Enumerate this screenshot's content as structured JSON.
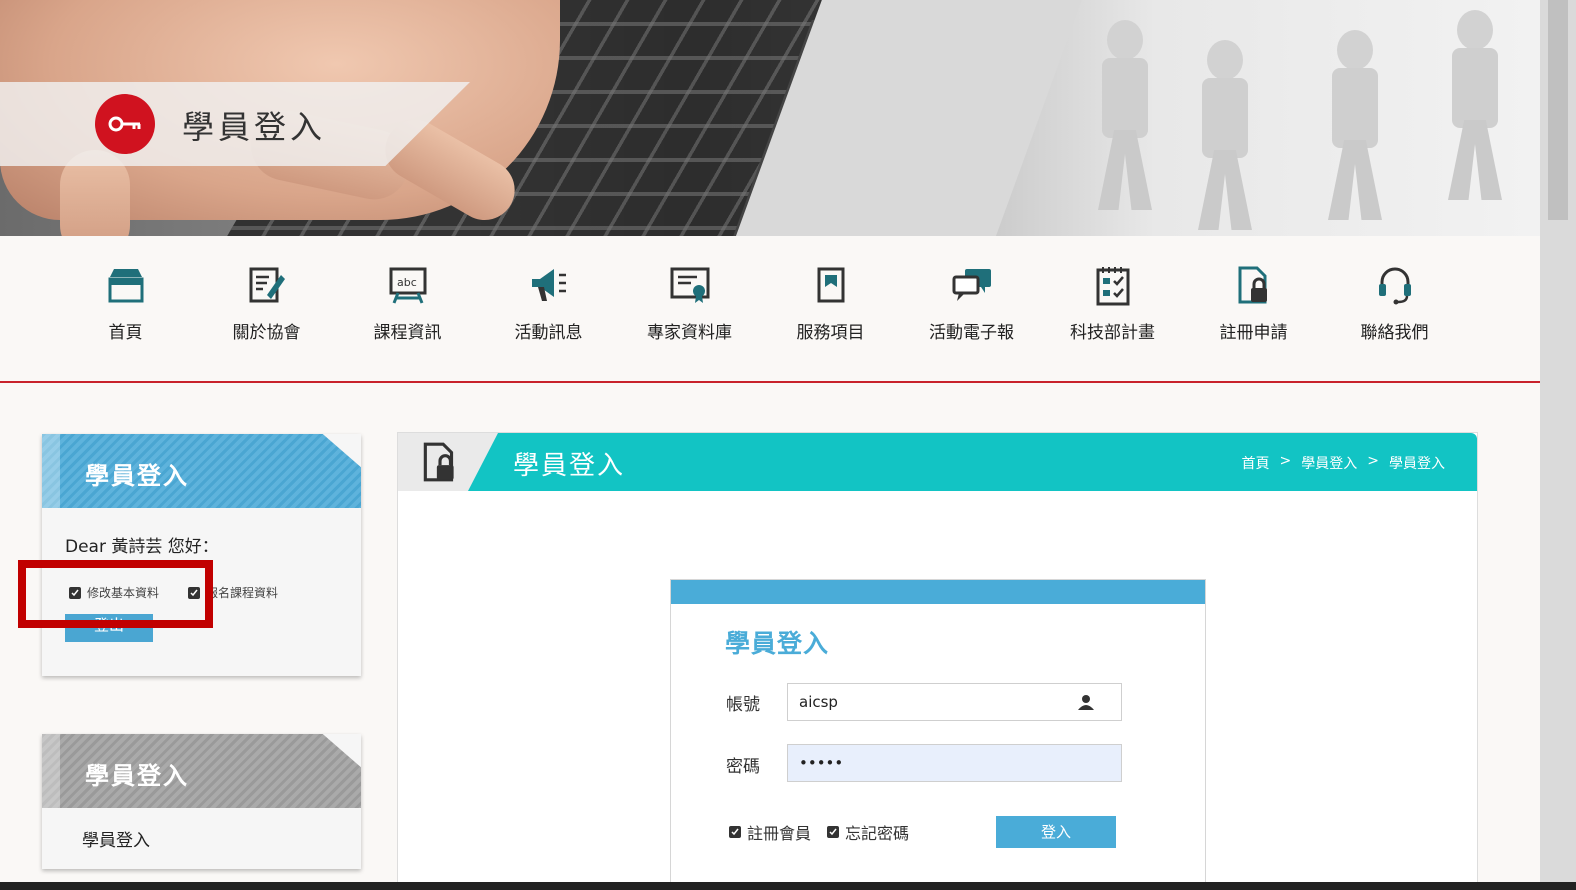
{
  "banner": {
    "title": "學員登入"
  },
  "nav": {
    "items": [
      {
        "label": "首頁",
        "icon": "home-icon"
      },
      {
        "label": "關於協會",
        "icon": "edit-note-icon"
      },
      {
        "label": "課程資訊",
        "icon": "abc-board-icon"
      },
      {
        "label": "活動訊息",
        "icon": "megaphone-icon"
      },
      {
        "label": "專家資料庫",
        "icon": "certificate-icon"
      },
      {
        "label": "服務項目",
        "icon": "bookmark-icon"
      },
      {
        "label": "活動電子報",
        "icon": "chat-bubbles-icon"
      },
      {
        "label": "科技部計畫",
        "icon": "checklist-icon"
      },
      {
        "label": "註冊申請",
        "icon": "lock-document-icon"
      },
      {
        "label": "聯絡我們",
        "icon": "headset-icon"
      }
    ]
  },
  "sidebar": {
    "member_card": {
      "title": "學員登入",
      "greeting": "Dear 黃詩芸 您好：",
      "links": [
        "修改基本資料",
        "報名課程資料"
      ],
      "logout_label": "登出"
    },
    "login_card": {
      "title": "學員登入",
      "item": "學員登入"
    }
  },
  "main": {
    "title": "學員登入",
    "breadcrumb": [
      "首頁",
      ">",
      "學員登入",
      ">",
      "學員登入"
    ]
  },
  "login_form": {
    "title": "學員登入",
    "account_label": "帳號",
    "account_value": "aicsp",
    "password_label": "密碼",
    "password_value": "•••••",
    "register_label": "註冊會員",
    "forgot_label": "忘記密碼",
    "submit_label": "登入"
  },
  "colors": {
    "accent_red": "#d0121f",
    "teal": "#12c4c4",
    "blue": "#4aacd8",
    "highlight": "#c10000"
  }
}
